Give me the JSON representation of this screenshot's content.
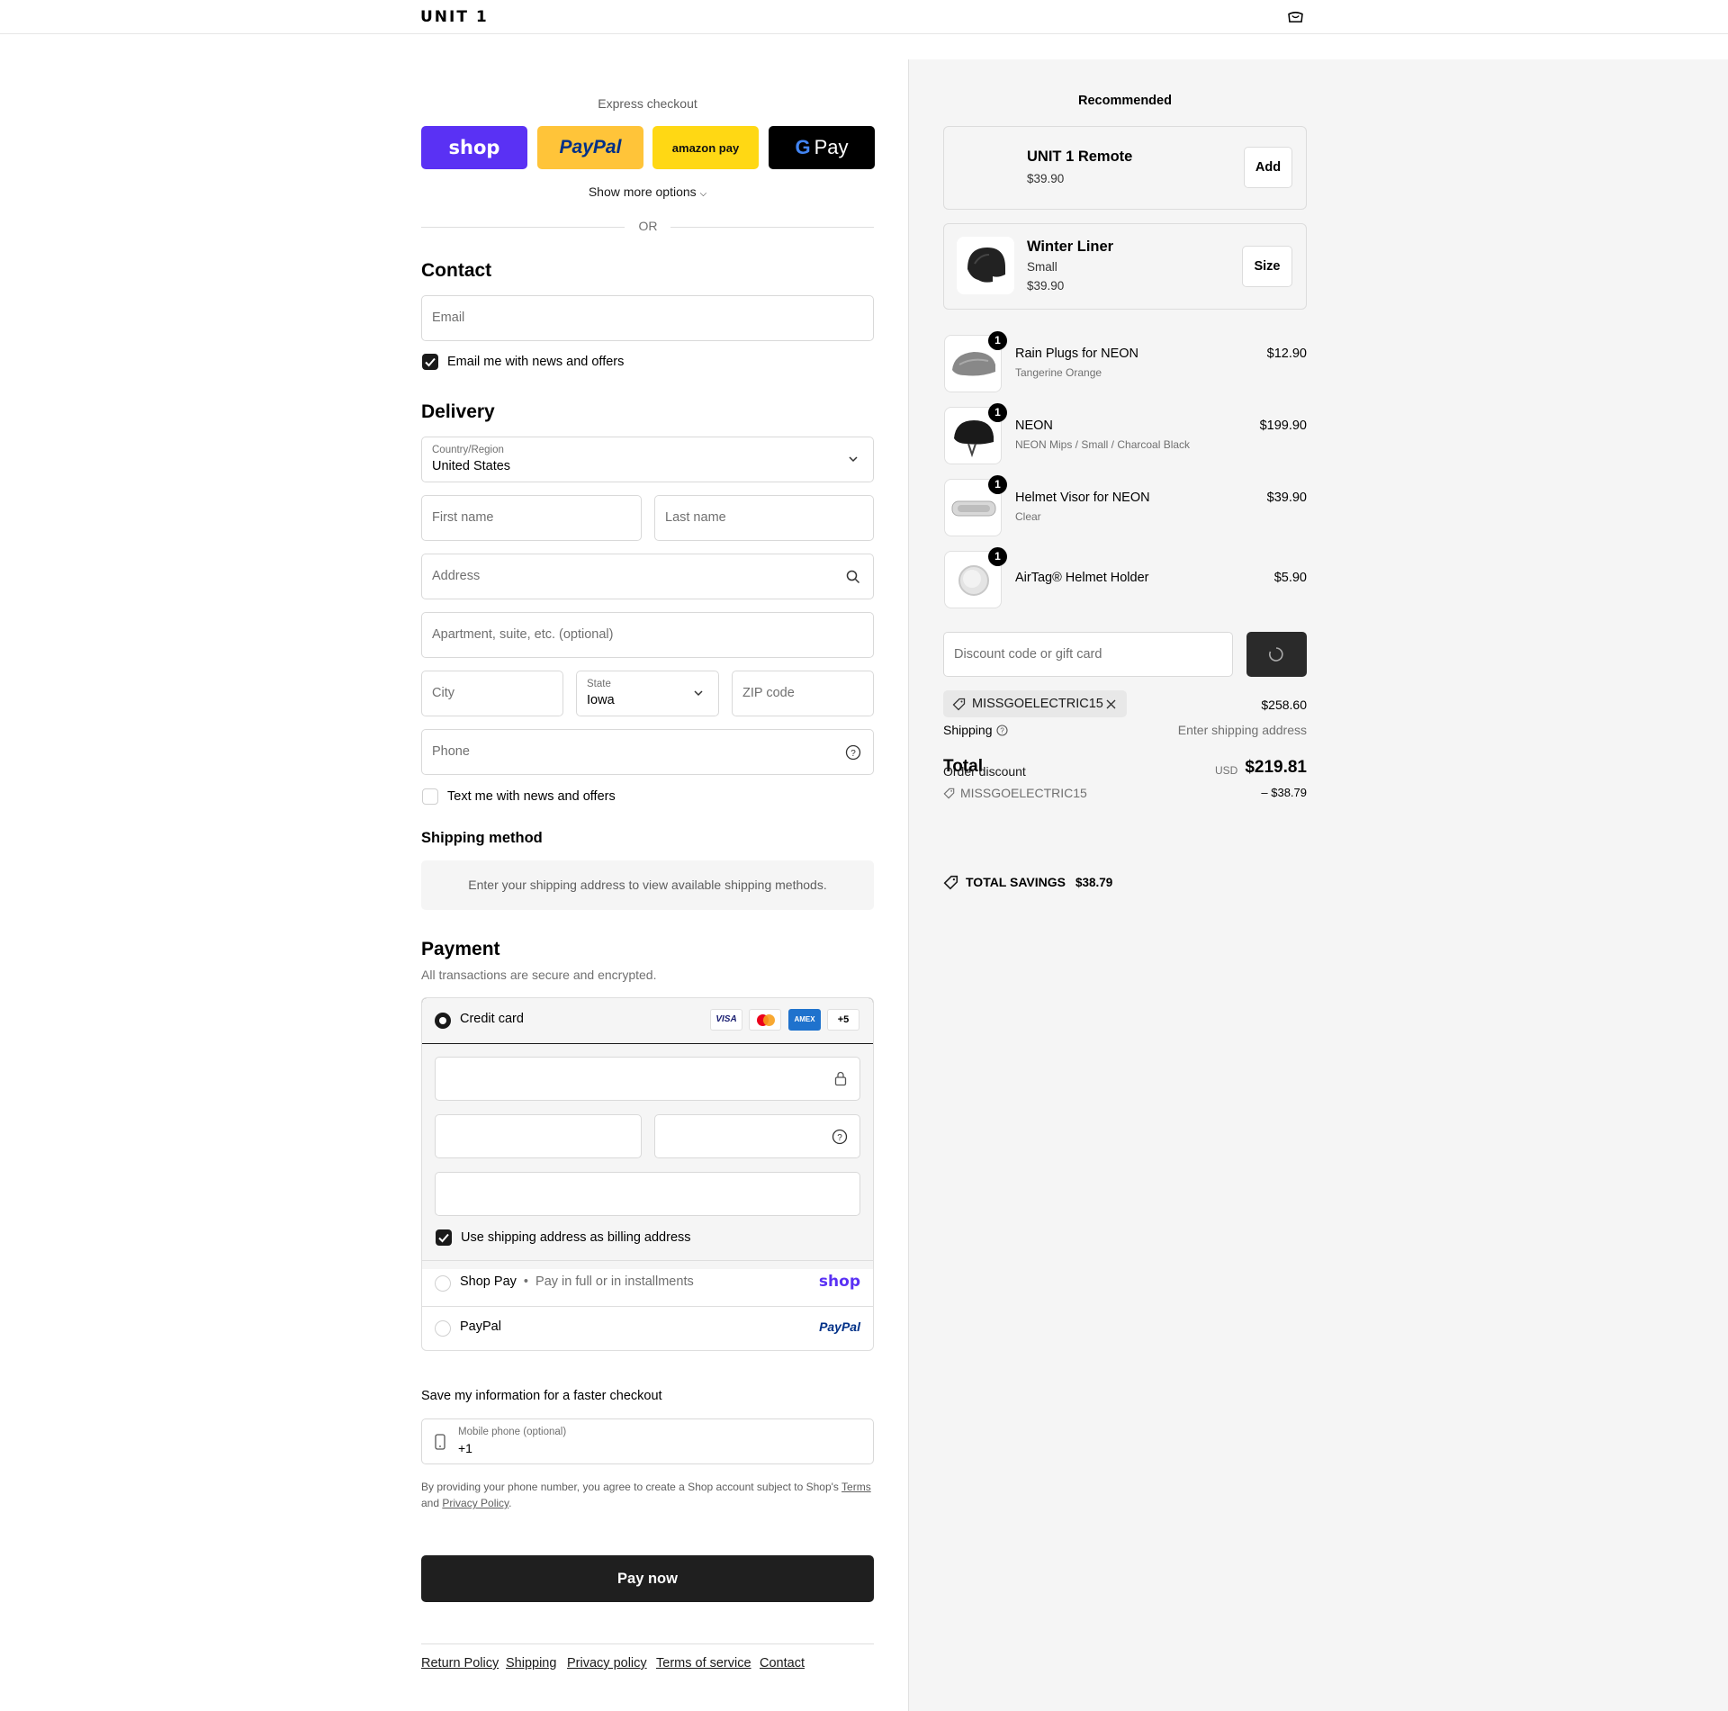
{
  "header": {
    "logo": "UNIT 1",
    "bag_icon": "bag-icon"
  },
  "express": {
    "title": "Express checkout",
    "buttons": [
      {
        "name": "shop-pay",
        "label": "shop",
        "bg": "#5a31f4",
        "fg": "#ffffff"
      },
      {
        "name": "paypal",
        "label": "PayPal",
        "bg": "#ffc439",
        "fg": "#003087"
      },
      {
        "name": "amazon-pay",
        "label": "amazon pay",
        "bg": "#ffd814",
        "fg": "#111111"
      },
      {
        "name": "google-pay",
        "label": "Pay",
        "bg": "#000000",
        "fg": "#ffffff"
      }
    ],
    "show_more": "Show more options",
    "or": "OR"
  },
  "contact": {
    "title": "Contact",
    "email_placeholder": "Email",
    "news_label": "Email me with news and offers",
    "news_checked": true
  },
  "delivery": {
    "title": "Delivery",
    "country_label": "Country/Region",
    "country_value": "United States",
    "first_name": "First name",
    "last_name": "Last name",
    "address": "Address",
    "apartment": "Apartment, suite, etc. (optional)",
    "city": "City",
    "state_label": "State",
    "state_value": "Iowa",
    "zip": "ZIP code",
    "phone": "Phone",
    "text_label": "Text me with news and offers",
    "text_checked": false
  },
  "shipping_method": {
    "title": "Shipping method",
    "message": "Enter your shipping address to view available shipping methods."
  },
  "payment": {
    "title": "Payment",
    "subtitle": "All transactions are secure and encrypted.",
    "credit_card_label": "Credit card",
    "card_brands": [
      "VISA",
      "MC",
      "AMEX",
      "+5"
    ],
    "billing_label": "Use shipping address as billing address",
    "billing_checked": true,
    "shop_pay_label": "Shop Pay",
    "shop_pay_sub": "Pay in full or in installments",
    "shop_pay_logo": "shop",
    "paypal_label": "PayPal",
    "paypal_logo": "PayPal"
  },
  "save_info": {
    "title": "Save my information for a faster checkout",
    "phone_label": "Mobile phone (optional)",
    "phone_value": "+1",
    "disclaimer_pre": "By providing your phone number, you agree to create a Shop account subject to Shop's",
    "terms": "Terms",
    "and": "and",
    "privacy": "Privacy Policy",
    "period": "."
  },
  "pay_now": "Pay now",
  "footer": {
    "links": [
      "Return Policy",
      "Shipping",
      "Privacy policy",
      "Terms of service",
      "Contact"
    ]
  },
  "summary": {
    "recommended_title": "Recommended",
    "recommended": [
      {
        "name": "UNIT 1 Remote",
        "price": "$39.90",
        "button": "Add"
      },
      {
        "name": "Winter Liner",
        "variant": "Small",
        "price": "$39.90",
        "button": "Size"
      }
    ],
    "items": [
      {
        "name": "Rain Plugs for NEON",
        "variant": "Tangerine Orange",
        "price": "$12.90",
        "qty": "1"
      },
      {
        "name": "NEON",
        "variant": "NEON Mips / Small / Charcoal Black",
        "price": "$199.90",
        "qty": "1"
      },
      {
        "name": "Helmet Visor for NEON",
        "variant": "Clear",
        "price": "$39.90",
        "qty": "1"
      },
      {
        "name": "AirTag® Helmet Holder",
        "variant": "",
        "price": "$5.90",
        "qty": "1"
      }
    ],
    "discount_placeholder": "Discount code or gift card",
    "discount_tag": "MISSGOELECTRIC15",
    "subtotal": "$258.60",
    "shipping_label": "Shipping",
    "shipping_value": "Enter shipping address",
    "total_label": "Total",
    "order_discount_label": "Order discount",
    "discount_code_line": "MISSGOELECTRIC15",
    "discount_amount": "– $38.79",
    "currency": "USD",
    "total": "$219.81",
    "savings_label": "TOTAL SAVINGS",
    "savings_value": "$38.79"
  },
  "colors": {
    "dark_button": "#1f1f1f",
    "summary_bg": "#f5f5f5",
    "shop_purple": "#5a31f4"
  }
}
